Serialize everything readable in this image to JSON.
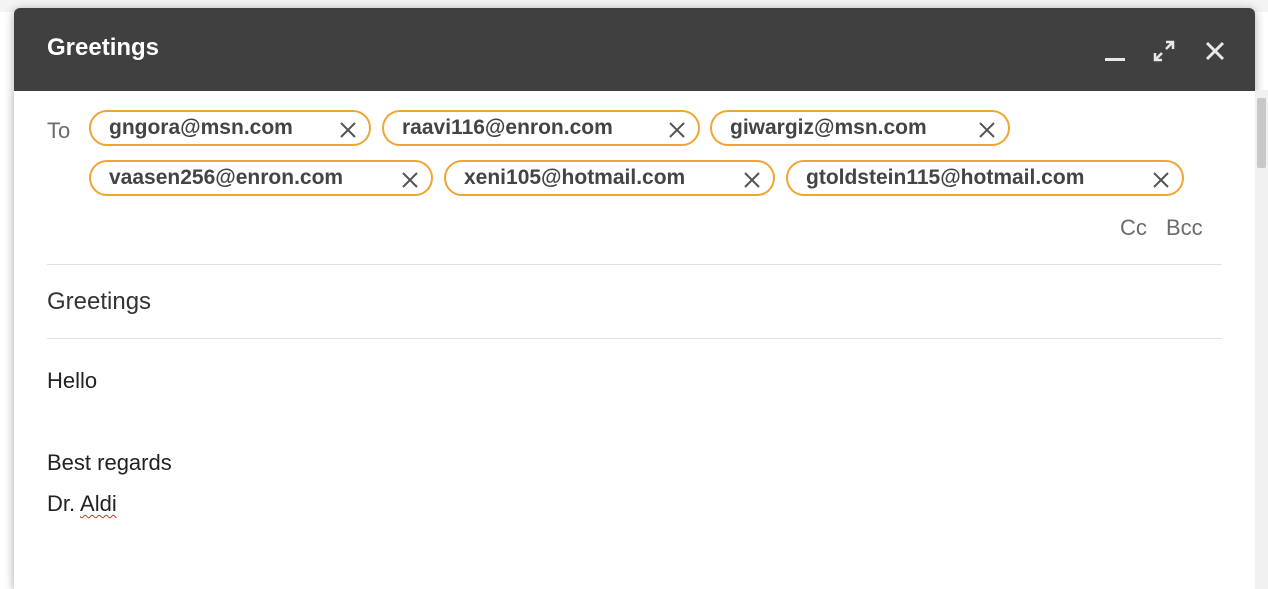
{
  "compose": {
    "title": "Greetings",
    "to_label": "To",
    "recipients": [
      "gngora@msn.com",
      "raavi116@enron.com",
      "giwargiz@msn.com",
      "vaasen256@enron.com",
      "xeni105@hotmail.com",
      "gtoldstein115@hotmail.com"
    ],
    "cc_label": "Cc",
    "bcc_label": "Bcc",
    "subject": "Greetings",
    "body": {
      "greeting": "Hello",
      "closing": "Best regards",
      "signature_prefix": "Dr.",
      "signature_name": "Aldi"
    }
  },
  "icons": {
    "minimize": "minimize-icon",
    "expand": "expand-icon",
    "close": "close-icon",
    "remove_recipient": "close-icon"
  },
  "colors": {
    "titlebar": "#404040",
    "chip_border": "#f0a532",
    "spellcheck": "#d93025"
  }
}
